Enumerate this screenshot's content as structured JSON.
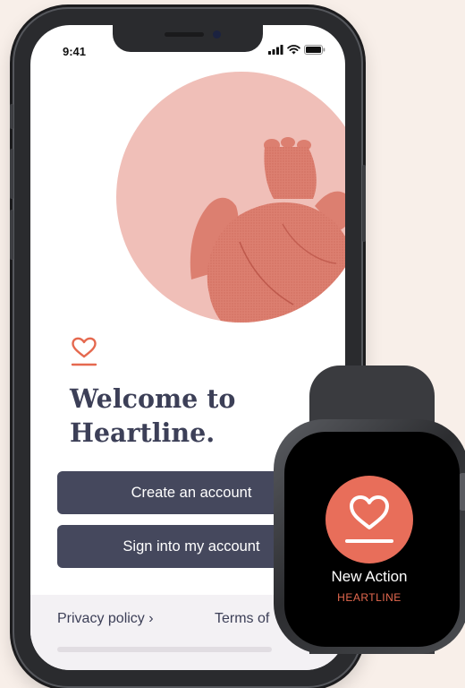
{
  "phone": {
    "status_bar": {
      "time": "9:41",
      "icons": [
        "cellular-signal-icon",
        "wifi-icon",
        "battery-icon"
      ]
    },
    "hero_image": "anatomical-heart-illustration",
    "logo_icon": "heart-outline-icon",
    "welcome_line1": "Welcome to",
    "welcome_line2": "Heartline.",
    "create_account_label": "Create an account",
    "sign_in_label": "Sign into my account",
    "privacy_label": "Privacy policy ›",
    "terms_label": "Terms of"
  },
  "watch": {
    "icon": "heart-outline-icon",
    "title": "New Action",
    "subtitle": "HEARTLINE"
  },
  "colors": {
    "background": "#f8efe9",
    "button": "#45485d",
    "heading": "#3c3f57",
    "accent": "#e5694f",
    "hero_circle": "#f0bfb8"
  }
}
